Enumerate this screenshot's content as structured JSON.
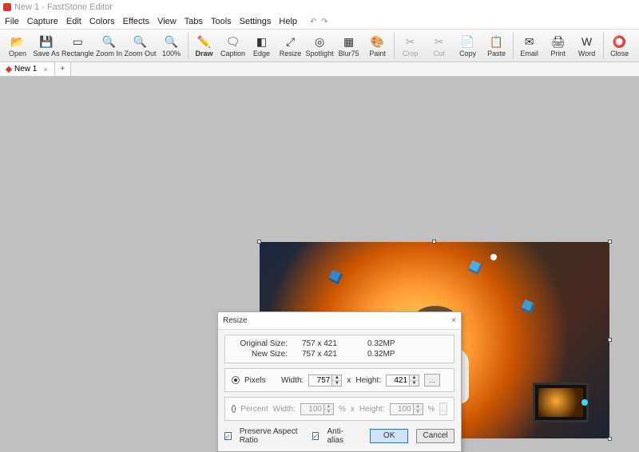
{
  "title": "New 1 - FastStone Editor",
  "menu": [
    "File",
    "Capture",
    "Edit",
    "Colors",
    "Effects",
    "View",
    "Tabs",
    "Tools",
    "Settings",
    "Help"
  ],
  "toolbar": [
    {
      "label": "Open",
      "icon": "📂",
      "en": true
    },
    {
      "label": "Save As",
      "icon": "💾",
      "en": true
    },
    {
      "label": "Rectangle",
      "icon": "▭",
      "en": true
    },
    {
      "label": "Zoom In",
      "icon": "🔍",
      "en": true
    },
    {
      "label": "Zoom Out",
      "icon": "🔍",
      "en": true
    },
    {
      "label": "100%",
      "icon": "🔍",
      "en": true
    },
    {
      "sep": true
    },
    {
      "label": "Draw",
      "icon": "✏️",
      "en": true,
      "bold": true
    },
    {
      "label": "Caption",
      "icon": "🗨",
      "en": true
    },
    {
      "label": "Edge",
      "icon": "◧",
      "en": true
    },
    {
      "label": "Resize",
      "icon": "⤢",
      "en": true
    },
    {
      "label": "Spotlight",
      "icon": "◎",
      "en": true
    },
    {
      "label": "Blur75",
      "icon": "▦",
      "en": true
    },
    {
      "label": "Paint",
      "icon": "🎨",
      "en": true
    },
    {
      "sep": true
    },
    {
      "label": "Crop",
      "icon": "✂",
      "en": false
    },
    {
      "label": "Cut",
      "icon": "✂",
      "en": false
    },
    {
      "label": "Copy",
      "icon": "📄",
      "en": true
    },
    {
      "label": "Paste",
      "icon": "📋",
      "en": true
    },
    {
      "sep": true
    },
    {
      "label": "Email",
      "icon": "✉",
      "en": true
    },
    {
      "label": "Print",
      "icon": "🖨",
      "en": true
    },
    {
      "label": "Word",
      "icon": "W",
      "en": true
    },
    {
      "sep": true
    },
    {
      "label": "Close",
      "icon": "⭕",
      "en": true
    }
  ],
  "tab": {
    "name": "New 1",
    "close": "×",
    "add": "+"
  },
  "dialog": {
    "title": "Resize",
    "orig_lbl": "Original Size:",
    "orig_dim": "757 x 421",
    "orig_mp": "0.32MP",
    "new_lbl": "New Size:",
    "new_dim": "757 x 421",
    "new_mp": "0.32MP",
    "pixels": "Pixels",
    "percent": "Percent",
    "width_lbl": "Width:",
    "height_lbl": "Height:",
    "w_px": "757",
    "h_px": "421",
    "w_pc": "100",
    "h_pc": "100",
    "x": "x",
    "pct": "%",
    "dots": "...",
    "preserve": "Preserve Aspect Ratio",
    "antialias": "Anti-alias",
    "ok": "OK",
    "cancel": "Cancel",
    "close_x": "×"
  }
}
